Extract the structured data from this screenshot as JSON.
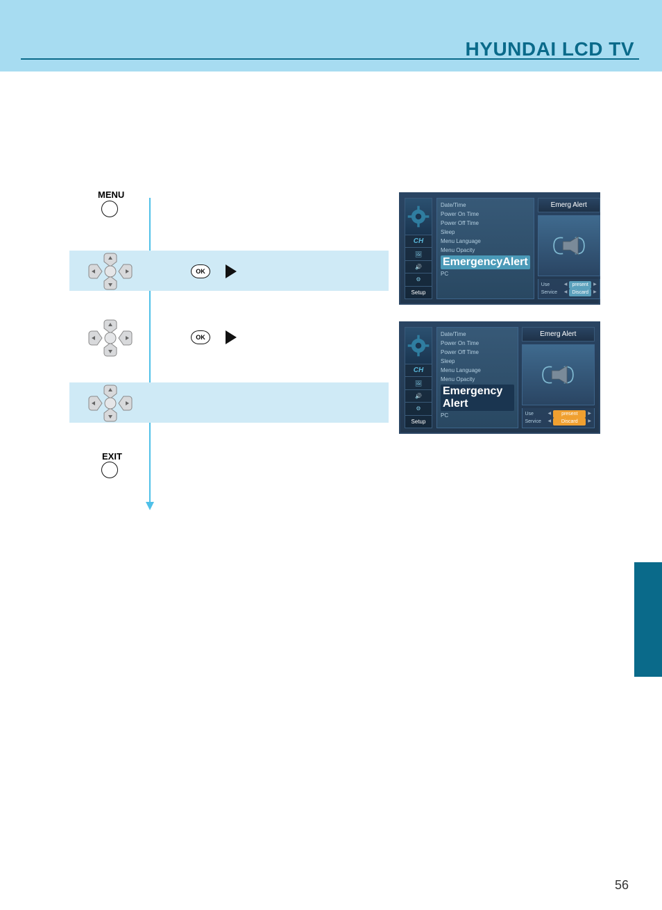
{
  "header": {
    "title": "HYUNDAI LCD TV"
  },
  "page_number": "56",
  "controls": {
    "menu_label": "MENU",
    "exit_label": "EXIT",
    "ok_label": "OK"
  },
  "osd_screens": [
    {
      "title": "Emerg Alert",
      "sidebar_tabs": [
        "CH",
        "",
        "",
        "",
        "Setup"
      ],
      "list": [
        "Date/Time",
        "Power On Time",
        "Power Off Time",
        "Sleep",
        "Menu Language",
        "Menu Opacity"
      ],
      "selected": "EmergencyAlert",
      "after": [
        "PC"
      ],
      "settings": [
        {
          "label": "Use",
          "value": "present",
          "highlighted": false
        },
        {
          "label": "Service",
          "value": "Discard",
          "highlighted": false
        }
      ],
      "selected_setting": -1
    },
    {
      "title": "Emerg Alert",
      "sidebar_tabs": [
        "CH",
        "",
        "",
        "",
        "Setup"
      ],
      "list": [
        "Date/Time",
        "Power On Time",
        "Power Off Time",
        "Sleep",
        "Menu Language",
        "Menu Opacity"
      ],
      "selected": "Emergency Alert",
      "after": [
        "PC"
      ],
      "settings": [
        {
          "label": "Use",
          "value": "present",
          "highlighted": true
        },
        {
          "label": "Service",
          "value": "Discard",
          "highlighted": true
        }
      ],
      "selected_setting": 0
    }
  ]
}
